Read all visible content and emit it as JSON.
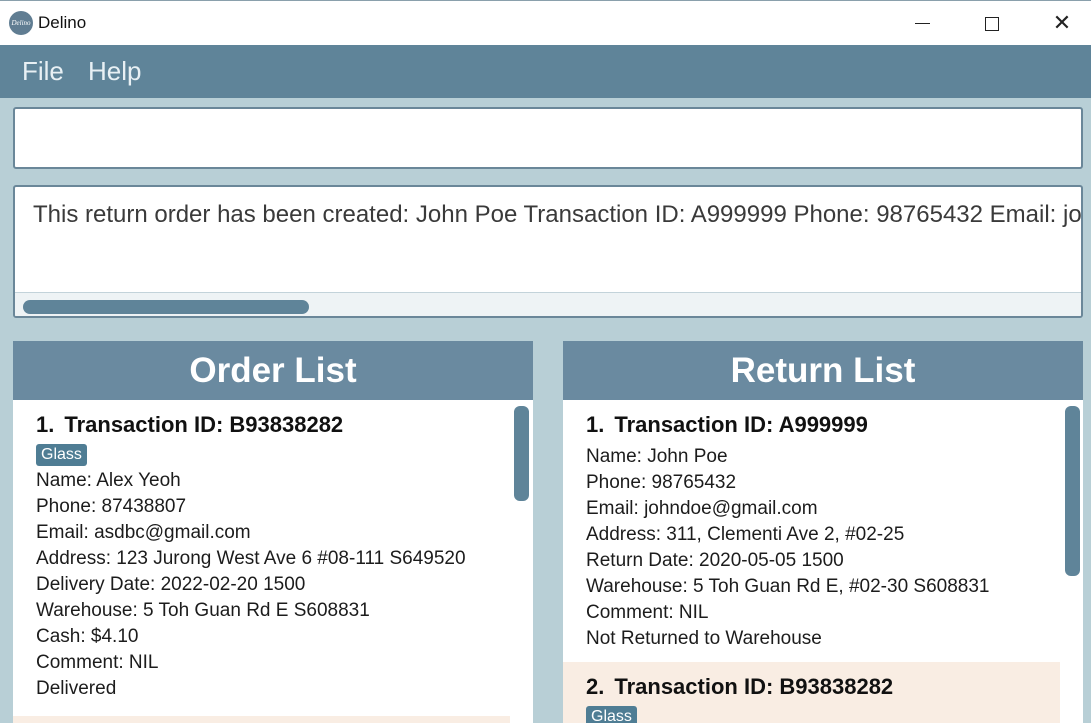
{
  "window": {
    "icon_text": "Delino",
    "title": "Delino",
    "minimize": "—",
    "close": "✕"
  },
  "menu": {
    "file": "File",
    "help": "Help"
  },
  "command_box": {
    "value": ""
  },
  "result_box": {
    "text": "This return order has been created: John Poe Transaction ID: A999999 Phone: 98765432 Email: johndoe@gmail.com"
  },
  "order_list": {
    "title": "Order List",
    "items": [
      {
        "index": "1.",
        "title": "Transaction ID: B93838282",
        "tag": "Glass",
        "fields": [
          "Name: Alex Yeoh",
          "Phone: 87438807",
          "Email: asdbc@gmail.com",
          "Address: 123 Jurong West Ave 6 #08-111 S649520",
          "Delivery Date: 2022-02-20 1500",
          "Warehouse: 5 Toh Guan Rd E S608831",
          "Cash: $4.10",
          "Comment: NIL",
          "Delivered"
        ]
      }
    ]
  },
  "return_list": {
    "title": "Return List",
    "items": [
      {
        "index": "1.",
        "title": "Transaction ID: A999999",
        "fields": [
          "Name: John Poe",
          "Phone: 98765432",
          "Email: johndoe@gmail.com",
          "Address: 311, Clementi Ave 2, #02-25",
          "Return Date: 2020-05-05 1500",
          "Warehouse: 5 Toh Guan Rd E, #02-30 S608831",
          "Comment: NIL",
          "Not Returned to Warehouse"
        ]
      },
      {
        "index": "2.",
        "title": "Transaction ID: B93838282",
        "tag": "Glass"
      }
    ]
  },
  "colors": {
    "accent": "#5f8499",
    "background": "#b8cfd6",
    "panel_header": "#6a8aa0",
    "alt_card": "#f9ede3",
    "tag": "#4f7d94"
  }
}
